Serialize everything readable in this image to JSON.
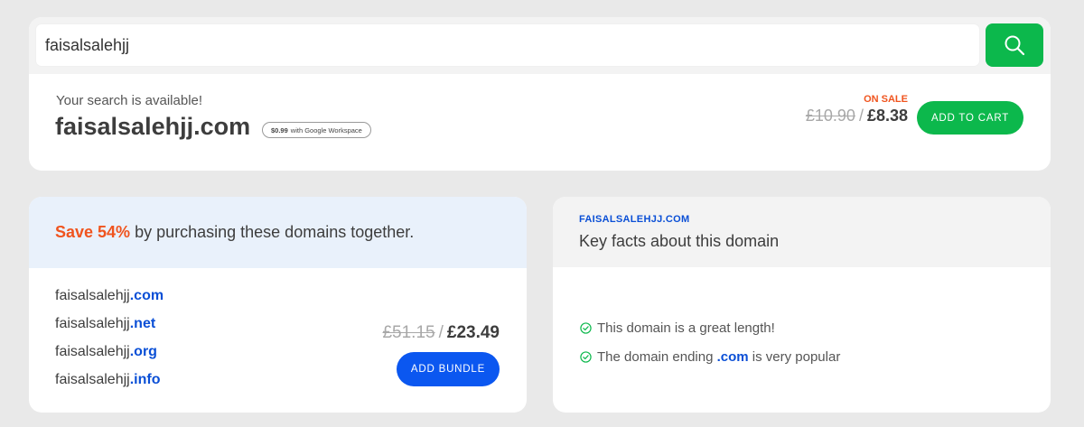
{
  "search": {
    "value": "faisalsalehjj",
    "button_icon": "search-icon"
  },
  "result": {
    "label": "Your search is available!",
    "domain": "faisalsalehjj.com",
    "badge_price": "$0.99",
    "badge_text": "with Google Workspace",
    "on_sale": "ON SALE",
    "old_price": "£10.90",
    "separator": "/",
    "new_price": "£8.38",
    "add_to_cart": "ADD TO CART"
  },
  "bundle": {
    "save_text": "Save 54%",
    "title_rest": " by purchasing these domains together.",
    "items": [
      {
        "name": "faisalsalehjj",
        "tld": ".com"
      },
      {
        "name": "faisalsalehjj",
        "tld": ".net"
      },
      {
        "name": "faisalsalehjj",
        "tld": ".org"
      },
      {
        "name": "faisalsalehjj",
        "tld": ".info"
      }
    ],
    "old_price": "£51.15",
    "separator": "/",
    "new_price": "£23.49",
    "add_bundle": "ADD BUNDLE"
  },
  "facts": {
    "domain": "FAISALSALEHJJ.COM",
    "title": "Key facts about this domain",
    "items": [
      {
        "before": "This domain is a great length!",
        "strong": "",
        "after": ""
      },
      {
        "before": "The domain ending ",
        "strong": ".com",
        "after": " is very popular"
      }
    ]
  },
  "colors": {
    "green": "#0cb84c",
    "blue": "#0b57f0",
    "orange": "#f0541e",
    "link_blue": "#0a4fd6"
  }
}
